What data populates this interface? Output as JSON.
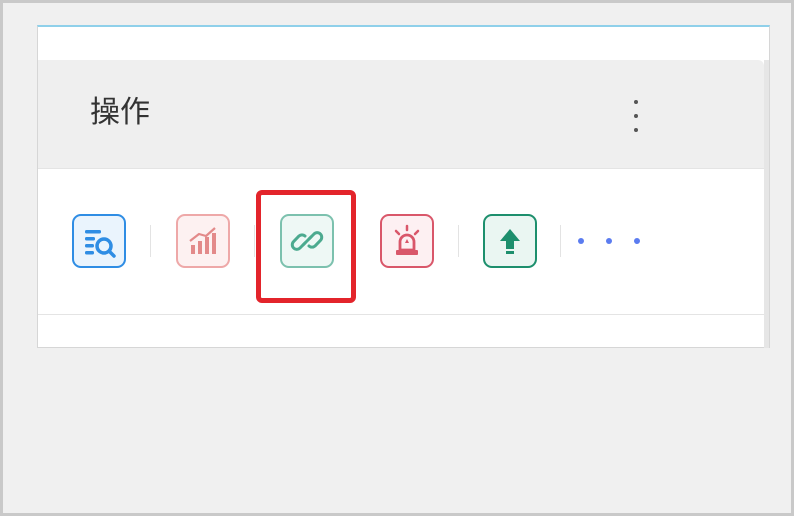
{
  "panel": {
    "title": "操作"
  },
  "actions": [
    {
      "id": "query",
      "icon": "list-search-icon",
      "color": "#2f8de4"
    },
    {
      "id": "stats",
      "icon": "bar-chart-icon",
      "color": "#e38a8a"
    },
    {
      "id": "link",
      "icon": "link-icon",
      "color": "#4caa8f",
      "highlighted": true
    },
    {
      "id": "alarm",
      "icon": "alarm-light-icon",
      "color": "#d9576a"
    },
    {
      "id": "upload",
      "icon": "arrow-up-icon",
      "color": "#1d8f6d"
    },
    {
      "id": "more",
      "icon": "more-dots-icon",
      "color": "#5b7cf0"
    }
  ],
  "colors": {
    "highlight": "#e3242b",
    "panel_top_border": "#8fd0ea",
    "header_bg": "#efefef"
  }
}
